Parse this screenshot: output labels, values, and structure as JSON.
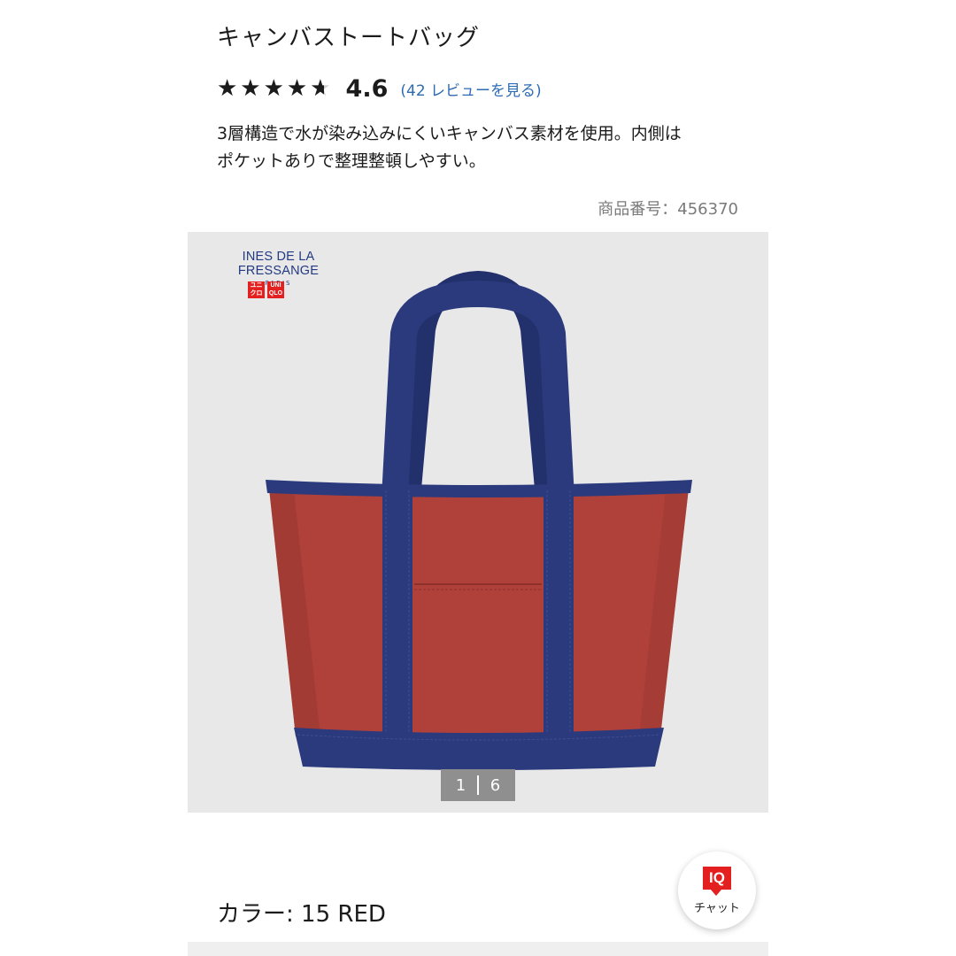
{
  "product": {
    "title": "キャンバストートバッグ",
    "rating_value": 4.6,
    "rating_text": "4.6",
    "rating_max": 5,
    "stars_glyphs": "★★★★★",
    "review_link": "(42 レビューを見る)",
    "description_line1": "3層構造で水が染み込みにくいキャンバス素材を使用。内側は",
    "description_line2": "ポケットありで整理整頓しやすい。",
    "product_number": "商品番号：456370"
  },
  "gallery": {
    "brand_name": "INES DE LA FRESSANGE",
    "brand_sub": "PARIS",
    "logo_ja": [
      "ユニ",
      "クロ"
    ],
    "logo_en": [
      "UNI",
      "QLO"
    ],
    "image_label": "red canvas tote bag with navy handles",
    "pager_current": "1",
    "pager_total": "6",
    "bag_body_color": "#b0413a",
    "bag_trim_color": "#2b3a7d",
    "background_color": "#e8e8e8"
  },
  "chat": {
    "badge": "IQ",
    "label": "チャット"
  },
  "color_selection": {
    "label": "カラー: 15 RED"
  },
  "colors": {
    "accent_red": "#e41f1f",
    "link_blue": "#2d6bb4",
    "navy": "#233a82"
  }
}
